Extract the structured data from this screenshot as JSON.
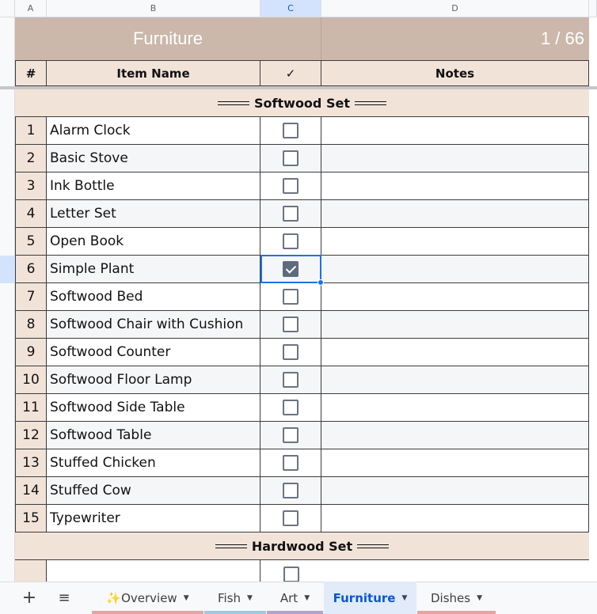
{
  "columns": [
    "A",
    "B",
    "C",
    "D"
  ],
  "sheet_title": "Furniture",
  "progress": "1 / 66",
  "headers": {
    "num": "#",
    "name": "Item Name",
    "check": "✓",
    "notes": "Notes"
  },
  "sections": [
    {
      "title": "Softwood Set"
    },
    {
      "title": "Hardwood Set"
    }
  ],
  "rows": [
    {
      "n": "1",
      "name": "Alarm Clock",
      "checked": false
    },
    {
      "n": "2",
      "name": "Basic Stove",
      "checked": false
    },
    {
      "n": "3",
      "name": "Ink Bottle",
      "checked": false
    },
    {
      "n": "4",
      "name": "Letter Set",
      "checked": false
    },
    {
      "n": "5",
      "name": "Open Book",
      "checked": false
    },
    {
      "n": "6",
      "name": "Simple Plant",
      "checked": true
    },
    {
      "n": "7",
      "name": "Softwood Bed",
      "checked": false
    },
    {
      "n": "8",
      "name": "Softwood Chair with Cushion",
      "checked": false
    },
    {
      "n": "9",
      "name": "Softwood Counter",
      "checked": false
    },
    {
      "n": "10",
      "name": "Softwood Floor Lamp",
      "checked": false
    },
    {
      "n": "11",
      "name": "Softwood Side Table",
      "checked": false
    },
    {
      "n": "12",
      "name": "Softwood Table",
      "checked": false
    },
    {
      "n": "13",
      "name": "Stuffed Chicken",
      "checked": false
    },
    {
      "n": "14",
      "name": "Stuffed Cow",
      "checked": false
    },
    {
      "n": "15",
      "name": "Typewriter",
      "checked": false
    }
  ],
  "tabs": [
    {
      "label": "+",
      "icon": "add-sheet-icon"
    },
    {
      "label": "≡",
      "icon": "all-sheets-icon"
    },
    {
      "label": "✨Overview",
      "color": "#e6a3a3"
    },
    {
      "label": "Fish",
      "color": "#9fc9e0"
    },
    {
      "label": "Art",
      "color": "#b3a2cf"
    },
    {
      "label": "Furniture",
      "color": "#cbb8aa",
      "active": true
    },
    {
      "label": "Dishes",
      "color": "#e6a3a3"
    }
  ]
}
